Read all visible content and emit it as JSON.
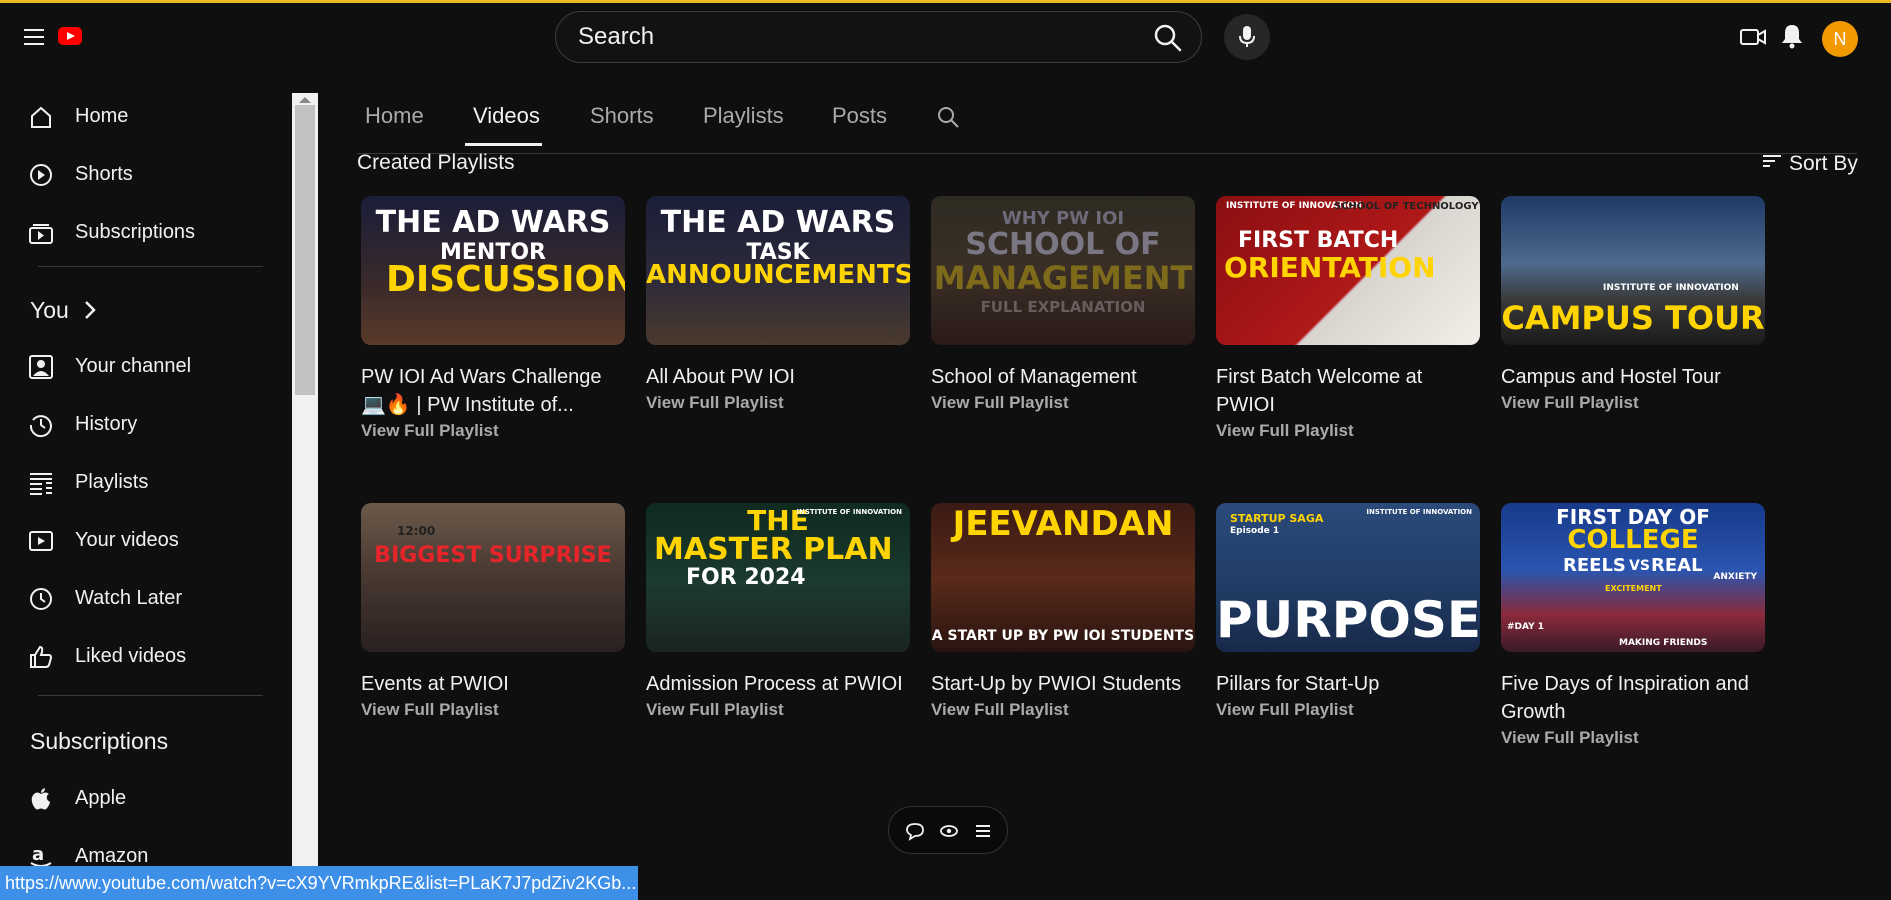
{
  "search": {
    "placeholder": "Search"
  },
  "user": {
    "avatar_letter": "N"
  },
  "sidebar": {
    "primary": [
      {
        "label": "Home",
        "icon": "home-icon"
      },
      {
        "label": "Shorts",
        "icon": "shorts-icon"
      },
      {
        "label": "Subscriptions",
        "icon": "subscriptions-icon"
      }
    ],
    "you_heading": "You",
    "you_items": [
      {
        "label": "Your channel",
        "icon": "your-channel-icon"
      },
      {
        "label": "History",
        "icon": "history-icon"
      },
      {
        "label": "Playlists",
        "icon": "playlists-icon"
      },
      {
        "label": "Your videos",
        "icon": "your-videos-icon"
      },
      {
        "label": "Watch Later",
        "icon": "watch-later-icon"
      },
      {
        "label": "Liked videos",
        "icon": "liked-videos-icon"
      }
    ],
    "subscriptions_heading": "Subscriptions",
    "subscriptions": [
      {
        "label": "Apple",
        "icon": "apple-icon"
      },
      {
        "label": "Amazon",
        "icon": "amazon-icon"
      }
    ]
  },
  "channel_tabs": [
    {
      "label": "Home",
      "active": false
    },
    {
      "label": "Videos",
      "active": true
    },
    {
      "label": "Shorts",
      "active": false
    },
    {
      "label": "Playlists",
      "active": false
    },
    {
      "label": "Posts",
      "active": false
    }
  ],
  "section": {
    "title": "Created Playlists",
    "sort_label": "Sort By"
  },
  "playlists": [
    {
      "title": "PW IOI Ad Wars Challenge 💻🔥 | PW Institute of...",
      "sub": "View Full Playlist",
      "thumb_text": [
        "THE AD WARS",
        "MENTOR",
        "DISCUSSION"
      ]
    },
    {
      "title": "All About PW IOI",
      "sub": "View Full Playlist",
      "thumb_text": [
        "THE AD WARS",
        "TASK",
        "ANNOUNCEMENTS"
      ]
    },
    {
      "title": "School of Management",
      "sub": "View Full Playlist",
      "thumb_text": [
        "WHY PW IOI",
        "SCHOOL OF",
        "MANAGEMENT",
        "FULL EXPLANATION"
      ]
    },
    {
      "title": "First Batch Welcome at PWIOI",
      "sub": "View Full Playlist",
      "thumb_text": [
        "INSTITUTE OF INNOVATION",
        "SCHOOL OF TECHNOLOGY",
        "FIRST BATCH",
        "ORIENTATION"
      ]
    },
    {
      "title": "Campus and Hostel Tour",
      "sub": "View Full Playlist",
      "thumb_text": [
        "INSTITUTE OF INNOVATION",
        "CAMPUS TOUR"
      ]
    },
    {
      "title": "Events at PWIOI",
      "sub": "View Full Playlist",
      "thumb_text": [
        "12:00",
        "BIGGEST SURPRISE"
      ]
    },
    {
      "title": "Admission Process at PWIOI",
      "sub": "View Full Playlist",
      "thumb_text": [
        "THE",
        "MASTER PLAN",
        "FOR 2024",
        "INSTITUTE OF INNOVATION"
      ]
    },
    {
      "title": "Start-Up by PWIOI Students",
      "sub": "View Full Playlist",
      "thumb_text": [
        "JEEVANDAN",
        "A START UP BY PW IOI STUDENTS"
      ]
    },
    {
      "title": "Pillars for Start-Up",
      "sub": "View Full Playlist",
      "thumb_text": [
        "STARTUP SAGA",
        "Episode 1",
        "PURPOSE",
        "INSTITUTE OF INNOVATION"
      ]
    },
    {
      "title": "Five Days of Inspiration and Growth",
      "sub": "View Full Playlist",
      "thumb_text": [
        "FIRST DAY OF",
        "COLLEGE",
        "REELS",
        "VS",
        "REAL",
        "#DAY 1",
        "EXCITEMENT",
        "MAKING FRIENDS",
        "ANXIETY"
      ]
    }
  ],
  "status_url": "https://www.youtube.com/watch?v=cX9YVRmkpRE&list=PLaK7J7pdZiv2KGb..."
}
